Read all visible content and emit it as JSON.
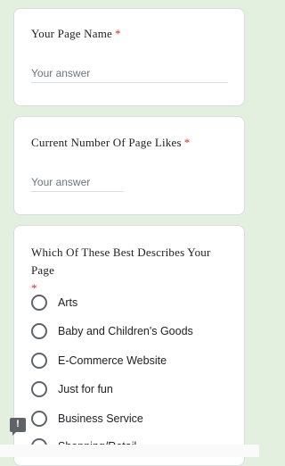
{
  "questions": [
    {
      "title": "Your Page Name",
      "required_mark": "*",
      "placeholder": "Your answer"
    },
    {
      "title": "Current Number Of Page Likes",
      "required_mark": "*",
      "placeholder": "Your answer"
    },
    {
      "title": "Which Of These Best Describes Your Page",
      "required_mark": "*",
      "options": [
        "Arts",
        "Baby and Children's Goods",
        "E-Commerce Website",
        "Just for fun",
        "Business Service",
        "Shopping/Retail"
      ]
    }
  ],
  "report_icon": "report-issue-icon",
  "report_glyph": "!"
}
